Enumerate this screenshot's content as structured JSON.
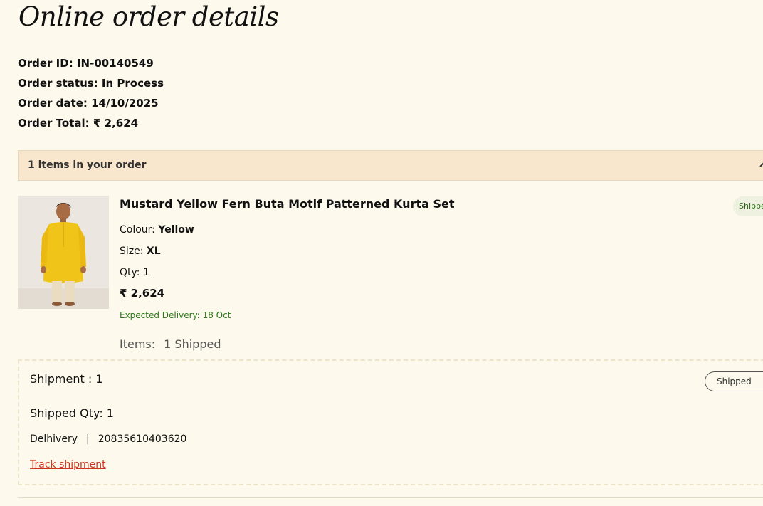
{
  "page": {
    "title": "Online order details"
  },
  "order": {
    "id_label": "Order ID:",
    "id_value": "IN-00140549",
    "status_label": "Order status:",
    "status_value": "In Process",
    "date_label": "Order date:",
    "date_value": "14/10/2025",
    "total_label": "Order Total:",
    "total_value": "₹ 2,624"
  },
  "items_bar": {
    "label": "1 items in your order",
    "chevron_icon": "chevron-up-icon"
  },
  "product": {
    "name": "Mustard Yellow Fern Buta Motif Patterned Kurta Set",
    "colour_label": "Colour:",
    "colour_value": "Yellow",
    "size_label": "Size:",
    "size_value": "XL",
    "qty_label": "Qty:",
    "qty_value": "1",
    "price": "₹ 2,624",
    "expected_delivery": "Expected Delivery: 18 Oct",
    "items_label": "Items:",
    "items_value": "1 Shipped",
    "status_badge": "Shipped",
    "image_icon": "product-photo"
  },
  "shipment": {
    "title": "Shipment : 1",
    "qty": "Shipped Qty: 1",
    "carrier": "Delhivery",
    "separator": "|",
    "tracking_number": "20835610403620",
    "track_link": "Track shipment",
    "status_badge": "Shipped"
  },
  "colors": {
    "background": "#fdf9ec",
    "items_bar": "#f8e7cd",
    "delivery_green": "#2b7a18",
    "link_red": "#d0341c",
    "kurta_yellow": "#f0c419"
  }
}
